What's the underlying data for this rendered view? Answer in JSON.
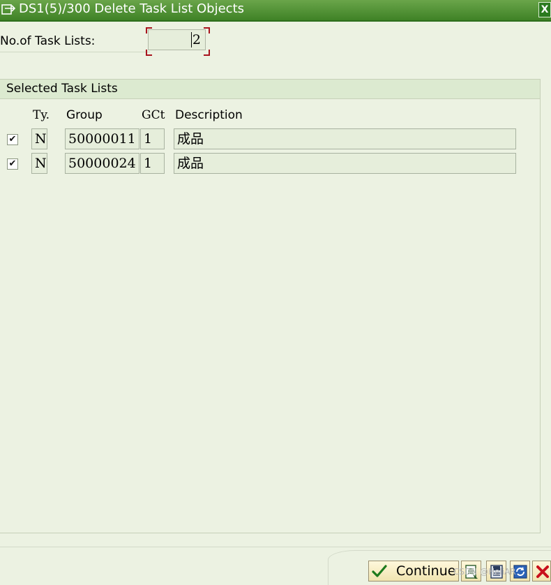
{
  "window": {
    "title": "DS1(5)/300 Delete Task List Objects"
  },
  "form": {
    "count_label": "No.of Task Lists:",
    "count_value": "2"
  },
  "group": {
    "title": "Selected Task Lists"
  },
  "columns": {
    "type": "Ty.",
    "group": "Group",
    "gct": "GCt",
    "description": "Description"
  },
  "rows": [
    {
      "selected": true,
      "checkbox_glyph": "✔",
      "type": "N",
      "group": "50000011",
      "gct": "1",
      "description": "成品"
    },
    {
      "selected": true,
      "checkbox_glyph": "✔",
      "type": "N",
      "group": "50000024",
      "gct": "1",
      "description": "成品"
    }
  ],
  "buttons": {
    "continue_label": "Continue",
    "close_glyph": "X"
  },
  "watermark": "CSDN @HeliAR",
  "icons": {
    "title": "dialog-icon",
    "continue": "check-icon",
    "b2": "document-icon",
    "b3": "save-icon",
    "b4": "refresh-icon",
    "b5": "cancel-icon"
  },
  "colors": {
    "title_bar": "#3f8226",
    "background": "#ecf2e2",
    "required_marker": "#a8141e"
  }
}
